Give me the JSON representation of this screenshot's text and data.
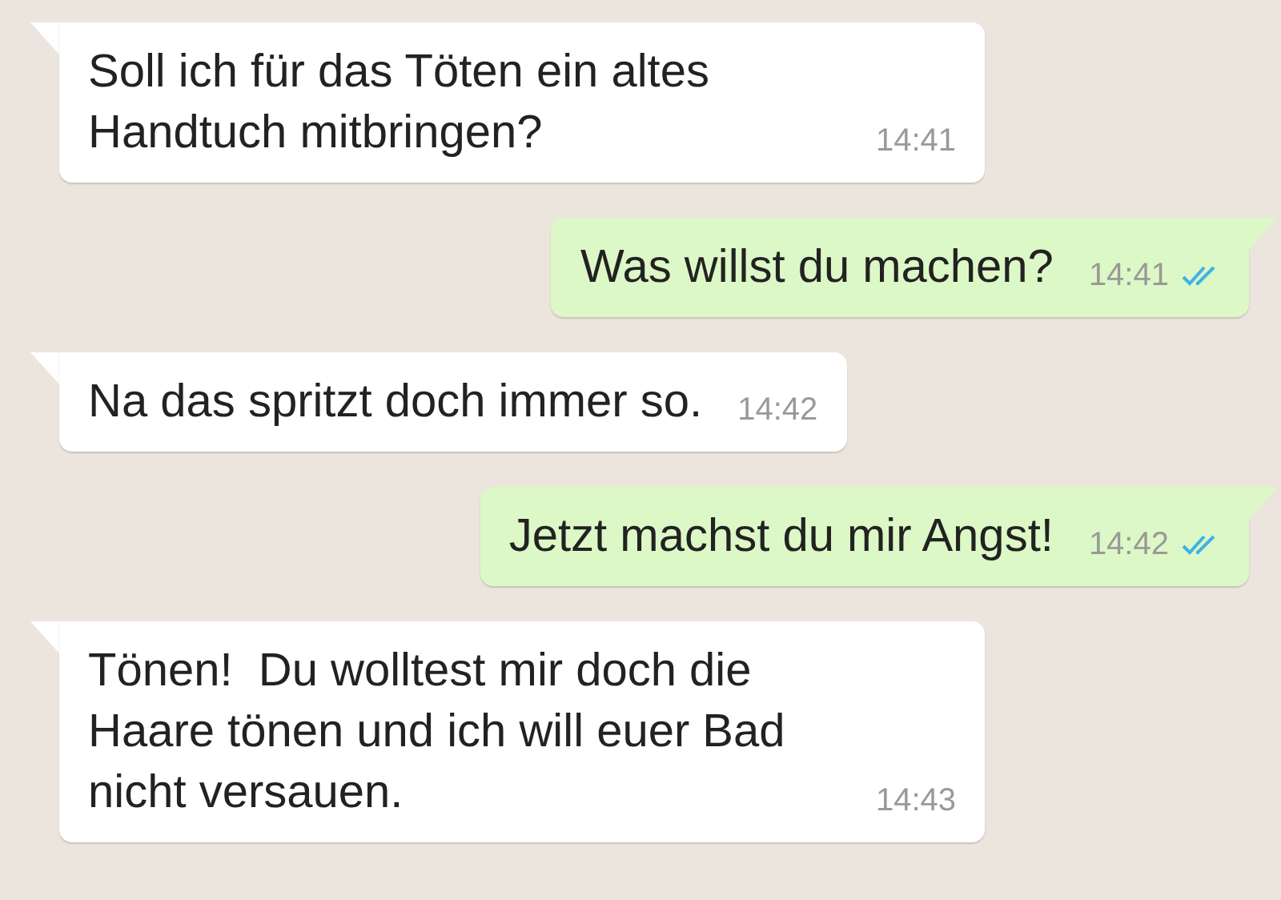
{
  "messages": [
    {
      "kind": "incoming",
      "text": "Soll ich für das Töten ein altes Handtuch mitbringen?",
      "time": "14:41"
    },
    {
      "kind": "outgoing",
      "text": "Was willst du machen?",
      "time": "14:41",
      "read": true
    },
    {
      "kind": "incoming",
      "text": "Na das spritzt doch immer so.",
      "time": "14:42"
    },
    {
      "kind": "outgoing",
      "text": "Jetzt machst du mir Angst!",
      "time": "14:42",
      "read": true
    },
    {
      "kind": "incoming",
      "text": "Tönen!  Du wolltest mir doch die Haare tönen und ich will euer Bad nicht versauen.",
      "time": "14:43"
    }
  ]
}
